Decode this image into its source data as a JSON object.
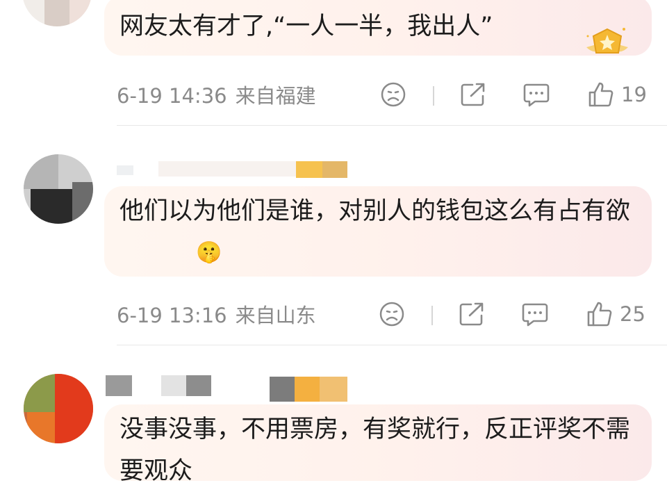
{
  "comments": [
    {
      "text": "网友太有才了,“一人一半，我出人”",
      "time": "6-19 14:36",
      "location": "来自福建",
      "likes": "19"
    },
    {
      "text": "他们以为他们是谁，对别人的钱包这么有占有欲",
      "emoji": "🤫",
      "time": "6-19 13:16",
      "location": "来自山东",
      "likes": "25"
    },
    {
      "text": "没事没事，不用票房，有奖就行，反正评奖不需要观众"
    }
  ],
  "icons": {
    "dislike": "sad-face-icon",
    "share": "share-icon",
    "reply": "comment-icon",
    "like": "thumbs-up-icon",
    "badge": "crown-badge-icon"
  },
  "colors": {
    "bubble": "#fff3ee",
    "meta_text": "#8a8a8a",
    "badge_gold": "#f5b833"
  }
}
